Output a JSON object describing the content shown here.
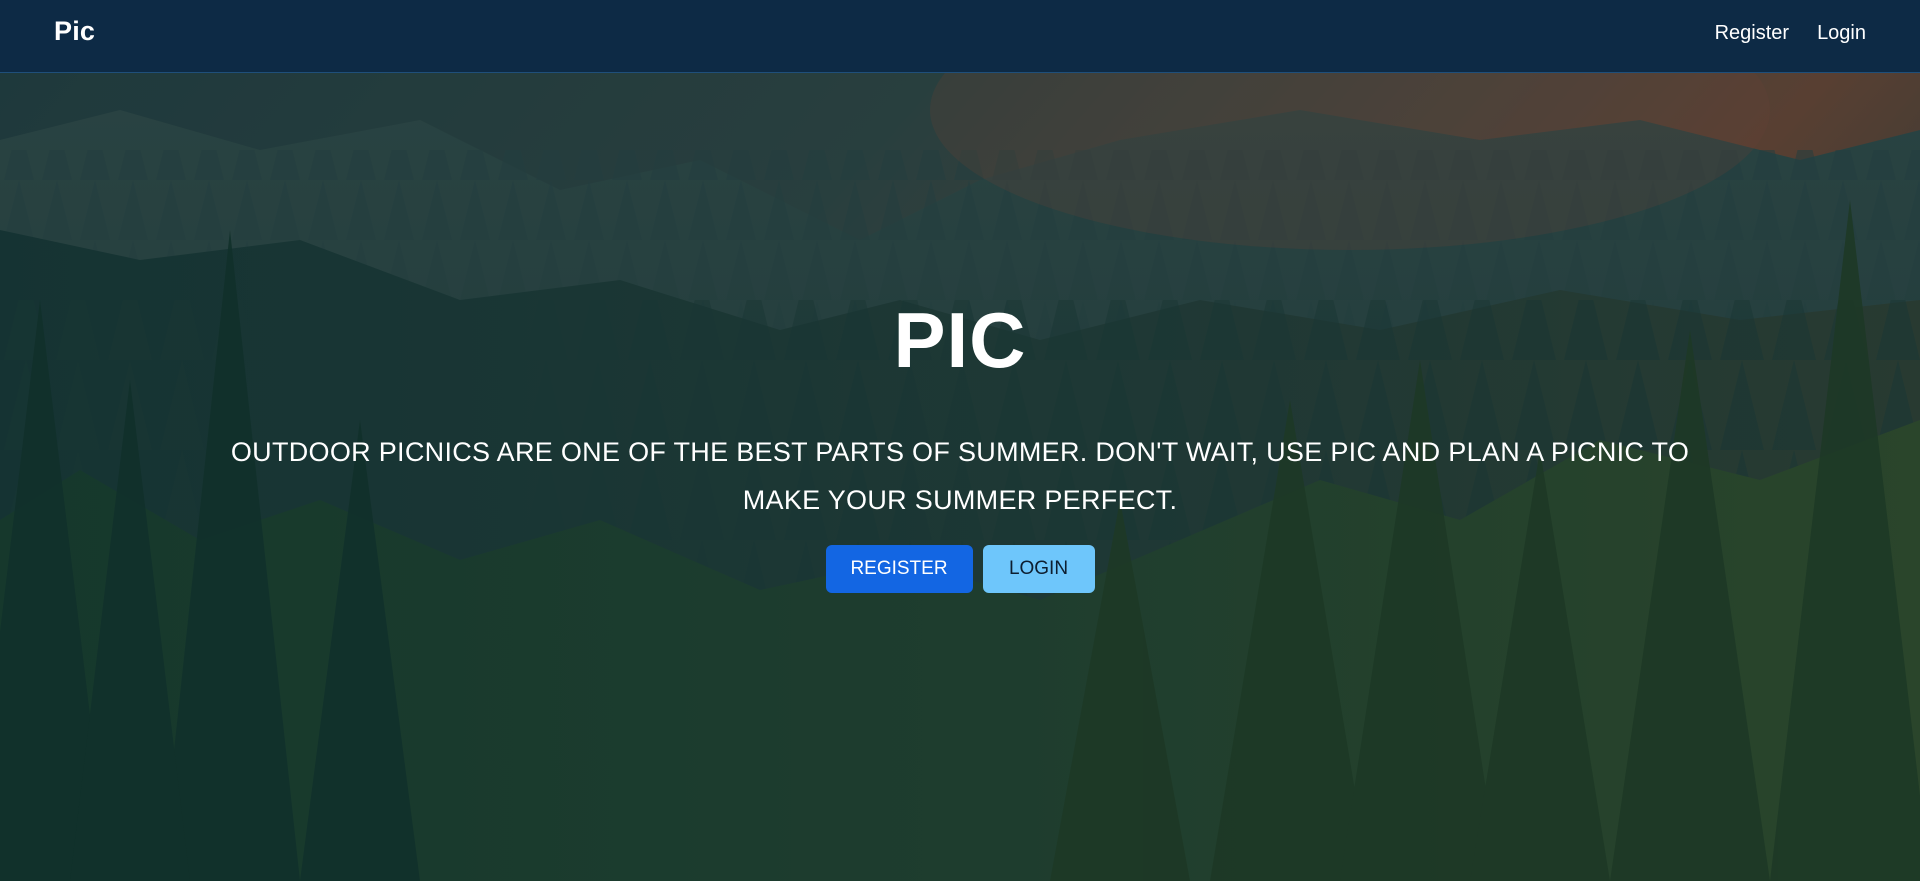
{
  "navbar": {
    "brand": "Pic",
    "links": [
      "Register",
      "Login"
    ]
  },
  "hero": {
    "title": "PIC",
    "subtitle": "Outdoor picnics are one of the best parts of summer. Don't wait, use Pic and plan a picnic to make your summer perfect.",
    "register_button": "REGISTER",
    "login_button": "LOGIN"
  },
  "colors": {
    "navbar_bg": "#0d2a45",
    "register_button_bg": "#1366e3",
    "login_button_bg": "#6ec6fb"
  }
}
